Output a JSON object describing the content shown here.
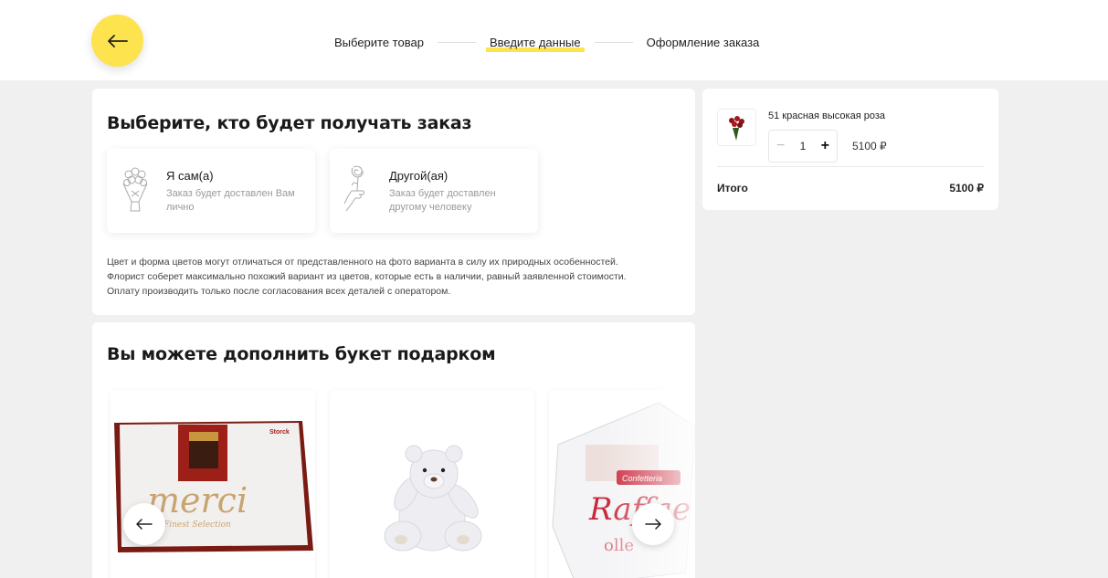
{
  "header": {
    "steps": [
      {
        "label": "Выберите товар",
        "active": false
      },
      {
        "label": "Введите данные",
        "active": true
      },
      {
        "label": "Оформление заказа",
        "active": false
      }
    ],
    "accent_color": "#fde34e"
  },
  "recipient": {
    "title": "Выберите, кто будет получать заказ",
    "options": [
      {
        "title": "Я сам(а)",
        "desc": "Заказ будет доставлен Вам лично",
        "icon": "bouquet-icon"
      },
      {
        "title": "Другой(ая)",
        "desc": "Заказ будет доставлен другому человеку",
        "icon": "hand-rose-icon"
      }
    ],
    "note": [
      "Цвет и форма цветов могут отличаться от представленного на фото варианта в силу их природных особенностей.",
      "Флорист соберет максимально похожий вариант из цветов, которые есть в наличии, равный заявленной стоимости.",
      "Оплату производить только после согласования всех деталей с оператором."
    ]
  },
  "gifts": {
    "title": "Вы можете дополнить букет подарком",
    "items": [
      {
        "name": "merci",
        "subtitle": "Finest Selection",
        "brand": "Storck",
        "icon": "chocolate-box-image"
      },
      {
        "name": "teddy bear",
        "icon": "teddy-bear-image"
      },
      {
        "name": "Raffaello",
        "subtitle": "Confetteria",
        "icon": "raffaello-box-image"
      }
    ]
  },
  "summary": {
    "product": {
      "name": "51 красная высокая роза",
      "qty": "1",
      "price": "5100 ₽"
    },
    "total_label": "Итого",
    "total_value": "5100 ₽"
  }
}
